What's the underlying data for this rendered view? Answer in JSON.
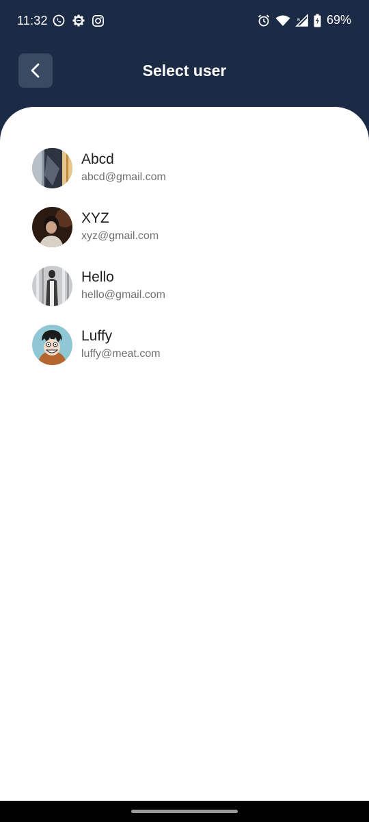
{
  "status_bar": {
    "time": "11:32",
    "battery": "69%",
    "left_icons": [
      "whatsapp-icon",
      "settings-gear-icon",
      "instagram-icon"
    ],
    "right_icons": [
      "alarm-icon",
      "wifi-icon",
      "signal-icon",
      "battery-icon"
    ]
  },
  "header": {
    "title": "Select user",
    "back_icon": "chevron-left-icon"
  },
  "users": [
    {
      "name": "Abcd",
      "email": "abcd@gmail.com"
    },
    {
      "name": "XYZ",
      "email": "xyz@gmail.com"
    },
    {
      "name": "Hello",
      "email": "hello@gmail.com"
    },
    {
      "name": "Luffy",
      "email": "luffy@meat.com"
    }
  ],
  "colors": {
    "header_bg": "#1c2b45",
    "back_button_bg": "#3a4a63",
    "content_bg": "#ffffff",
    "name_text": "#1f1f1f",
    "email_text": "#6f6f6f"
  }
}
